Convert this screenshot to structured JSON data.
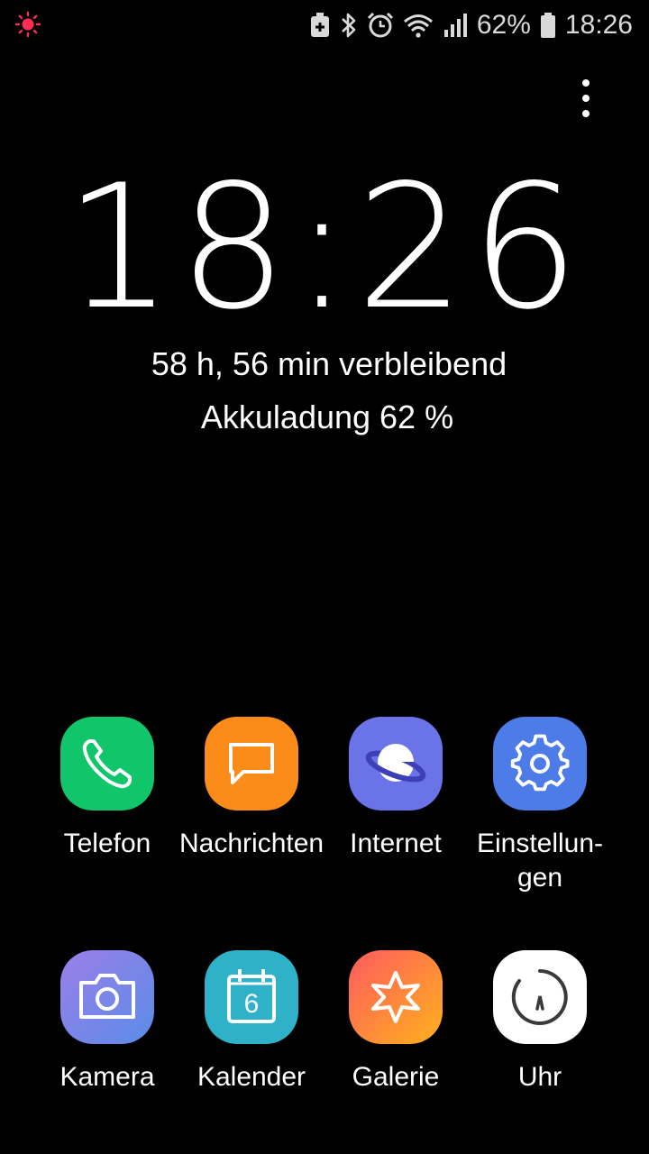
{
  "status_bar": {
    "battery_percent": "62%",
    "time": "18:26",
    "icons": [
      "sun-notification-icon",
      "battery-saver-icon",
      "bluetooth-icon",
      "alarm-icon",
      "wifi-icon",
      "signal-icon",
      "battery-icon"
    ]
  },
  "lockscreen": {
    "clock": "18:26",
    "remaining": "58 h, 56 min verbleibend",
    "charge": "Akkuladung 62 %"
  },
  "apps": [
    {
      "label": "Telefon",
      "color": "#10c56a"
    },
    {
      "label": "Nachrichten",
      "color": "#fb8c1a"
    },
    {
      "label": "Internet",
      "color": "#6b73e8"
    },
    {
      "label": "Einstellun-\ngen",
      "color": "#4d7ce8"
    },
    {
      "label": "Kamera",
      "color": "#7a7ee8"
    },
    {
      "label": "Kalender",
      "color": "#2fb2c8"
    },
    {
      "label": "Galerie",
      "color": "#fb6a3a"
    },
    {
      "label": "Uhr",
      "color": "#ffffff"
    }
  ],
  "calendar_day": "6",
  "accent_color": "#ff2d55"
}
